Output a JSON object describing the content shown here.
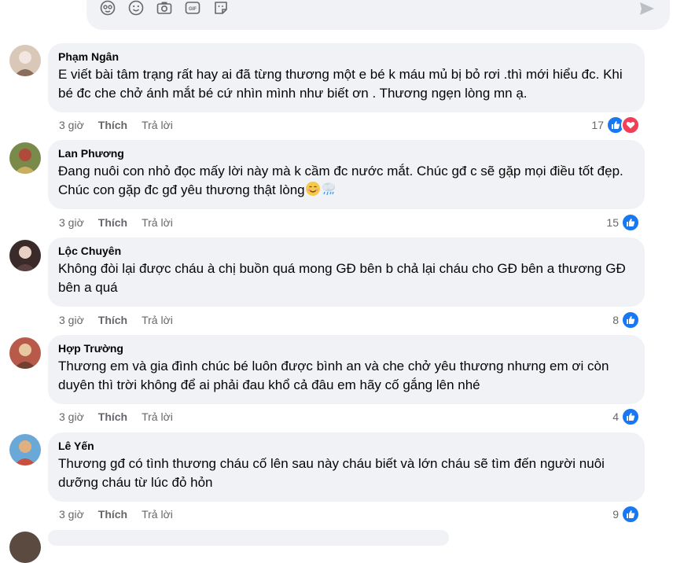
{
  "composer": {
    "icons": [
      "avatar-sticker-icon",
      "emoji-icon",
      "camera-icon",
      "gif-icon",
      "sticker-icon"
    ],
    "send_icon": "send-icon"
  },
  "comments": [
    {
      "author": "Phạm Ngân",
      "text": "E viết bài tâm trạng rất hay ai đã từng thương một e bé k máu mủ bị bỏ rơi .thì mới hiểu đc. Khi bé đc che chở ánh mắt bé cứ nhìn mình như biết ơn . Thương ngẹn lòng mn ạ.",
      "time": "3 giờ",
      "like_label": "Thích",
      "reply_label": "Trả lời",
      "reaction_count": "17",
      "reactions": [
        "like",
        "love"
      ]
    },
    {
      "author": "Lan Phương",
      "text": "Đang nuôi con nhỏ đọc mấy lời này mà k cầm đc nước mắt. Chúc gđ c sẽ gặp mọi điều tốt đẹp. Chúc con gặp đc gđ yêu thương thật lòng",
      "emojis": [
        "smiling-blush-emoji",
        "sweat-tears-emoji"
      ],
      "time": "3 giờ",
      "like_label": "Thích",
      "reply_label": "Trả lời",
      "reaction_count": "15",
      "reactions": [
        "like"
      ]
    },
    {
      "author": "Lộc Chuyên",
      "text": "Không đòi lại được cháu à chị buồn quá mong GĐ bên b chả lại cháu cho GĐ bên a thương GĐ bên a quá",
      "time": "3 giờ",
      "like_label": "Thích",
      "reply_label": "Trả lời",
      "reaction_count": "8",
      "reactions": [
        "like"
      ]
    },
    {
      "author": "Hợp Trường",
      "text": "Thương em và gia đình chúc bé luôn được bình an và che chở yêu thương nhưng em ơi còn duyên thì trời không để ai phải đau khổ cả đâu em hãy cố gắng lên nhé",
      "time": "3 giờ",
      "like_label": "Thích",
      "reply_label": "Trả lời",
      "reaction_count": "4",
      "reactions": [
        "like"
      ]
    },
    {
      "author": "Lê Yến",
      "text": "Thương gđ có tình thương cháu cố lên sau này cháu biết và lớn cháu sẽ tìm đến người nuôi dưỡng cháu từ lúc đỏ hỏn",
      "time": "3 giờ",
      "like_label": "Thích",
      "reply_label": "Trả lời",
      "reaction_count": "9",
      "reactions": [
        "like"
      ]
    }
  ]
}
